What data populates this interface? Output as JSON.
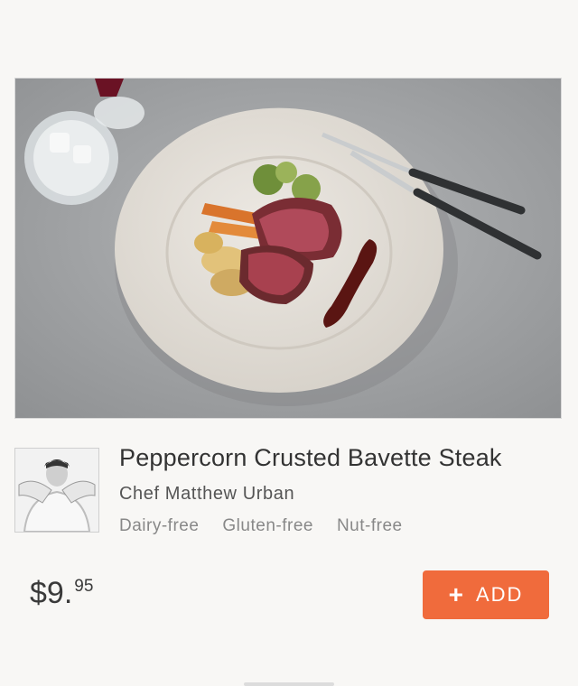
{
  "dish": {
    "title": "Peppercorn Crusted Bavette Steak",
    "chef": "Chef Matthew Urban",
    "tags": [
      "Dairy-free",
      "Gluten-free",
      "Nut-free"
    ]
  },
  "price": {
    "currency": "$",
    "dollars": "9.",
    "cents": "95"
  },
  "add_button": {
    "label": "ADD",
    "icon": "plus-icon"
  },
  "colors": {
    "accent": "#f06b3c",
    "background": "#f8f7f5"
  }
}
